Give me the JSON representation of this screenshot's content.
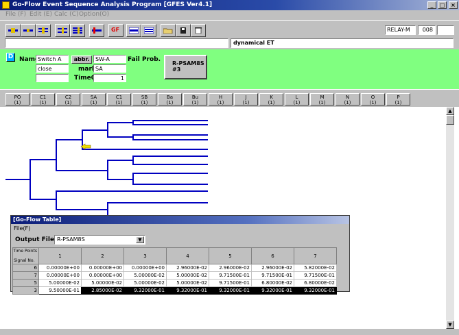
{
  "window": {
    "title": "Go-Flow Event Sequence Analysis Program [GFES Ver4.1]",
    "min": "_",
    "max": "□",
    "close": "×"
  },
  "menu": [
    "File (F)",
    "Edit (E)",
    "Calc (C)",
    "Option(O)"
  ],
  "toolbar": {
    "icons": [
      "line-icon",
      "line-icon",
      "line-icon",
      "join-icon",
      "join-icon",
      "split-icon",
      "gf-icon",
      "link-icon",
      "link-icon",
      "open-folder-icon",
      "save-icon",
      "delete-icon"
    ],
    "gf_label": "GF",
    "relay": "RELAY-M",
    "relay_num": "008"
  },
  "description": {
    "left": "",
    "right": "dynamical ET"
  },
  "node": {
    "badge": "D",
    "name_label": "Name",
    "name_value": "Switch A",
    "abbr_button": "abbr.",
    "abbr_value": "SW-A",
    "fail_label": "Fail Prob.",
    "state_value": "close",
    "mark_label": "mark",
    "mark_value": "SA",
    "time0_label": "Time0",
    "time0_value": "1",
    "prob_button_line1": "R-PSAM8S",
    "prob_button_line2": "#3"
  },
  "columns": [
    {
      "name": "PO",
      "sub": "(1)"
    },
    {
      "name": "C1",
      "sub": "(1)"
    },
    {
      "name": "C2",
      "sub": "(1)"
    },
    {
      "name": "SA",
      "sub": "(1)"
    },
    {
      "name": "C1",
      "sub": "(1)"
    },
    {
      "name": "SB",
      "sub": "(1)"
    },
    {
      "name": "Ba",
      "sub": "(1)"
    },
    {
      "name": "Bu",
      "sub": "(1)"
    },
    {
      "name": "H",
      "sub": "(1)"
    },
    {
      "name": "J",
      "sub": "(1)"
    },
    {
      "name": "K",
      "sub": "(1)"
    },
    {
      "name": "L",
      "sub": "(1)"
    },
    {
      "name": "M",
      "sub": "(1)"
    },
    {
      "name": "N",
      "sub": "(1)"
    },
    {
      "name": "O",
      "sub": "(1)"
    },
    {
      "name": "P",
      "sub": "(1)"
    }
  ],
  "table_window": {
    "title": "[Go-Flow Table]",
    "menu": "File(F)",
    "output_label": "Output File:",
    "output_file": "R-PSAM8S",
    "corner_signal": "Signal No.",
    "corner_time": "Time Points",
    "headers": [
      "1",
      "2",
      "3",
      "4",
      "5",
      "6",
      "7"
    ],
    "rows": [
      {
        "signal": "6",
        "values": [
          "0.00000E+00",
          "0.00000E+00",
          "0.00000E+00",
          "2.96000E-02",
          "2.96000E-02",
          "2.96000E-02",
          "5.82000E-02"
        ]
      },
      {
        "signal": "7",
        "values": [
          "0.00000E+00",
          "0.00000E+00",
          "5.00000E-02",
          "5.00000E-02",
          "9.71500E-01",
          "9.71500E-01",
          "9.71500E-01"
        ]
      },
      {
        "signal": "5",
        "values": [
          "5.00000E-02",
          "5.00000E-02",
          "5.00000E-02",
          "5.00000E-02",
          "9.71500E-01",
          "6.80000E-02",
          "6.80000E-02"
        ]
      },
      {
        "signal": "3",
        "values": [
          "9.50000E-01",
          "2.85000E-02",
          "9.32000E-01",
          "9.32000E-01",
          "9.32000E-01",
          "9.32000E-01",
          "9.32000E-01"
        ]
      }
    ]
  }
}
